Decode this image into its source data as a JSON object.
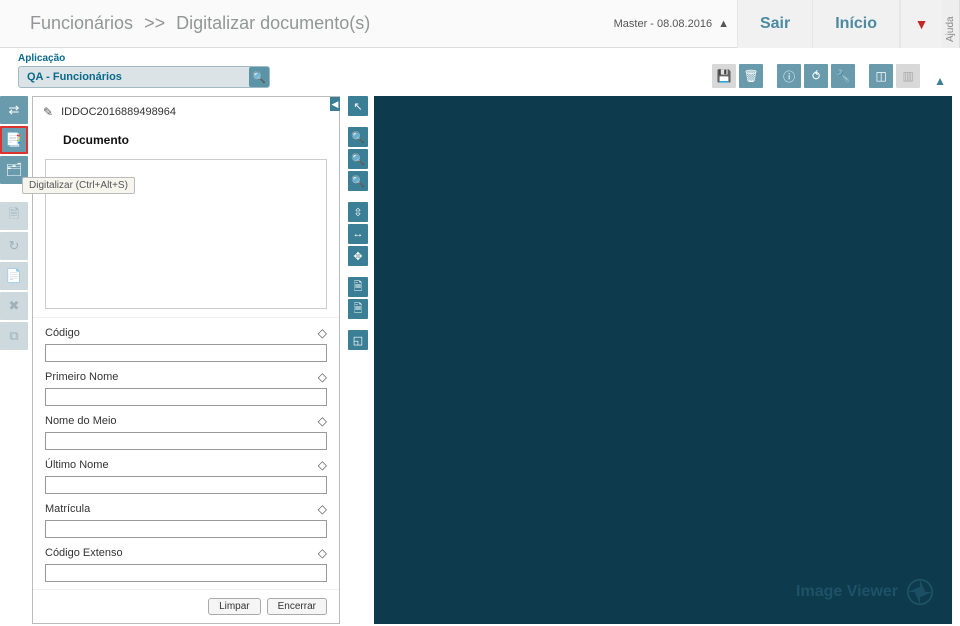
{
  "header": {
    "crumb1": "Funcionários",
    "crumb2": "Digitalizar documento(s)",
    "user": "Master - 08.08.2016",
    "exit": "Sair",
    "home": "Início",
    "help": "Ajuda"
  },
  "app": {
    "label": "Aplicação",
    "name": "QA - Funcionários"
  },
  "tooltip": "Digitalizar (Ctrl+Alt+S)",
  "doc": {
    "id": "IDDOC2016889498964",
    "title": "Documento"
  },
  "form": {
    "fields": [
      {
        "label": "Código",
        "value": ""
      },
      {
        "label": "Primeiro Nome",
        "value": ""
      },
      {
        "label": "Nome do Meio",
        "value": ""
      },
      {
        "label": "Último Nome",
        "value": ""
      },
      {
        "label": "Matrícula",
        "value": ""
      },
      {
        "label": "Código Extenso",
        "value": ""
      }
    ],
    "clear": "Limpar",
    "close": "Encerrar"
  },
  "viewer": {
    "watermark": "Image Viewer"
  }
}
